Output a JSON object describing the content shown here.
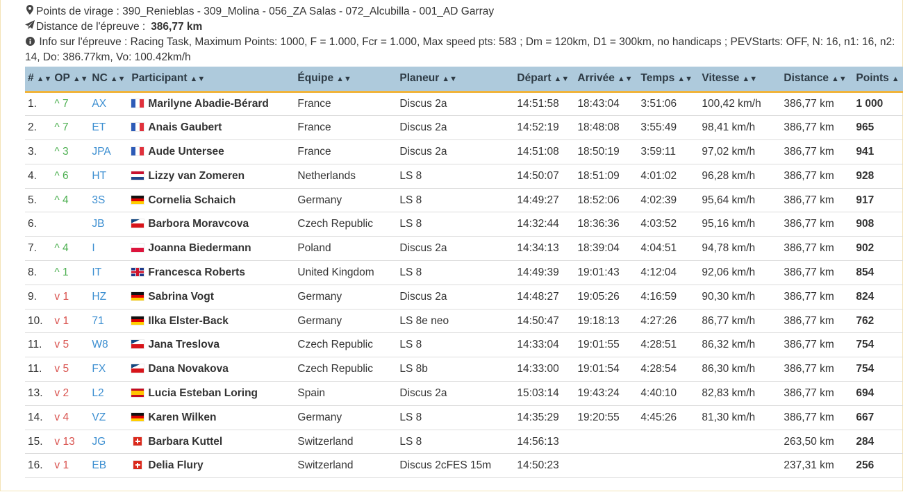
{
  "info": {
    "turnpoints_label": "Points de virage :",
    "turnpoints_value": "390_Renieblas - 309_Molina - 056_ZA Salas - 072_Alcubilla - 001_AD Garray",
    "distance_label": "Distance de l'épreuve :",
    "distance_value": "386,77 km",
    "task_info_label": "Info sur l'épreuve :",
    "task_info_value": "Racing Task, Maximum Points: 1000, F = 1.000, Fcr = 1.000, Max speed pts: 583 ; Dm = 120km, D1 = 300km, no handicaps ; PEVStarts: OFF, N: 16, n1: 16, n2: 14, Do: 386.77km, Vo: 100.42km/h"
  },
  "icons": {
    "turnpoints": "map-marker-icon",
    "distance": "paper-plane-icon",
    "info": "info-circle-icon"
  },
  "colors": {
    "header_bg": "#aecadc",
    "header_border": "#f0b43c",
    "up": "#4caf50",
    "down": "#d9534f",
    "link": "#3d8fd1"
  },
  "columns": [
    "#",
    "OP",
    "NC",
    "Participant",
    "Équipe",
    "Planeur",
    "Départ",
    "Arrivée",
    "Temps",
    "Vitesse",
    "Distance",
    "Points"
  ],
  "rows": [
    {
      "rank": "1.",
      "op": "^ 7",
      "dir": "up",
      "nc": "AX",
      "flag": "fr",
      "name": "Marilyne Abadie-Bérard",
      "team": "France",
      "glider": "Discus 2a",
      "start": "14:51:58",
      "finish": "18:43:04",
      "time": "3:51:06",
      "speed": "100,42 km/h",
      "distance": "386,77 km",
      "points": "1 000"
    },
    {
      "rank": "2.",
      "op": "^ 7",
      "dir": "up",
      "nc": "ET",
      "flag": "fr",
      "name": "Anais Gaubert",
      "team": "France",
      "glider": "Discus 2a",
      "start": "14:52:19",
      "finish": "18:48:08",
      "time": "3:55:49",
      "speed": "98,41 km/h",
      "distance": "386,77 km",
      "points": "965"
    },
    {
      "rank": "3.",
      "op": "^ 3",
      "dir": "up",
      "nc": "JPA",
      "flag": "fr",
      "name": "Aude Untersee",
      "team": "France",
      "glider": "Discus 2a",
      "start": "14:51:08",
      "finish": "18:50:19",
      "time": "3:59:11",
      "speed": "97,02 km/h",
      "distance": "386,77 km",
      "points": "941"
    },
    {
      "rank": "4.",
      "op": "^ 6",
      "dir": "up",
      "nc": "HT",
      "flag": "nl",
      "name": "Lizzy van Zomeren",
      "team": "Netherlands",
      "glider": "LS 8",
      "start": "14:50:07",
      "finish": "18:51:09",
      "time": "4:01:02",
      "speed": "96,28 km/h",
      "distance": "386,77 km",
      "points": "928"
    },
    {
      "rank": "5.",
      "op": "^ 4",
      "dir": "up",
      "nc": "3S",
      "flag": "de",
      "name": "Cornelia Schaich",
      "team": "Germany",
      "glider": "LS 8",
      "start": "14:49:27",
      "finish": "18:52:06",
      "time": "4:02:39",
      "speed": "95,64 km/h",
      "distance": "386,77 km",
      "points": "917"
    },
    {
      "rank": "6.",
      "op": "",
      "dir": "",
      "nc": "JB",
      "flag": "cz",
      "name": "Barbora Moravcova",
      "team": "Czech Republic",
      "glider": "LS 8",
      "start": "14:32:44",
      "finish": "18:36:36",
      "time": "4:03:52",
      "speed": "95,16 km/h",
      "distance": "386,77 km",
      "points": "908"
    },
    {
      "rank": "7.",
      "op": "^ 4",
      "dir": "up",
      "nc": "I",
      "flag": "pl",
      "name": "Joanna Biedermann",
      "team": "Poland",
      "glider": "Discus 2a",
      "start": "14:34:13",
      "finish": "18:39:04",
      "time": "4:04:51",
      "speed": "94,78 km/h",
      "distance": "386,77 km",
      "points": "902"
    },
    {
      "rank": "8.",
      "op": "^ 1",
      "dir": "up",
      "nc": "IT",
      "flag": "gb",
      "name": "Francesca Roberts",
      "team": "United Kingdom",
      "glider": "LS 8",
      "start": "14:49:39",
      "finish": "19:01:43",
      "time": "4:12:04",
      "speed": "92,06 km/h",
      "distance": "386,77 km",
      "points": "854"
    },
    {
      "rank": "9.",
      "op": "v 1",
      "dir": "down",
      "nc": "HZ",
      "flag": "de",
      "name": "Sabrina Vogt",
      "team": "Germany",
      "glider": "Discus 2a",
      "start": "14:48:27",
      "finish": "19:05:26",
      "time": "4:16:59",
      "speed": "90,30 km/h",
      "distance": "386,77 km",
      "points": "824"
    },
    {
      "rank": "10.",
      "op": "v 1",
      "dir": "down",
      "nc": "71",
      "flag": "de",
      "name": "Ilka Elster-Back",
      "team": "Germany",
      "glider": "LS 8e neo",
      "start": "14:50:47",
      "finish": "19:18:13",
      "time": "4:27:26",
      "speed": "86,77 km/h",
      "distance": "386,77 km",
      "points": "762"
    },
    {
      "rank": "11.",
      "op": "v 5",
      "dir": "down",
      "nc": "W8",
      "flag": "cz",
      "name": "Jana Treslova",
      "team": "Czech Republic",
      "glider": "LS 8",
      "start": "14:33:04",
      "finish": "19:01:55",
      "time": "4:28:51",
      "speed": "86,32 km/h",
      "distance": "386,77 km",
      "points": "754"
    },
    {
      "rank": "11.",
      "op": "v 5",
      "dir": "down",
      "nc": "FX",
      "flag": "cz",
      "name": "Dana Novakova",
      "team": "Czech Republic",
      "glider": "LS 8b",
      "start": "14:33:00",
      "finish": "19:01:54",
      "time": "4:28:54",
      "speed": "86,30 km/h",
      "distance": "386,77 km",
      "points": "754"
    },
    {
      "rank": "13.",
      "op": "v 2",
      "dir": "down",
      "nc": "L2",
      "flag": "es",
      "name": "Lucia Esteban Loring",
      "team": "Spain",
      "glider": "Discus 2a",
      "start": "15:03:14",
      "finish": "19:43:24",
      "time": "4:40:10",
      "speed": "82,83 km/h",
      "distance": "386,77 km",
      "points": "694"
    },
    {
      "rank": "14.",
      "op": "v 4",
      "dir": "down",
      "nc": "VZ",
      "flag": "de",
      "name": "Karen Wilken",
      "team": "Germany",
      "glider": "LS 8",
      "start": "14:35:29",
      "finish": "19:20:55",
      "time": "4:45:26",
      "speed": "81,30 km/h",
      "distance": "386,77 km",
      "points": "667"
    },
    {
      "rank": "15.",
      "op": "v 13",
      "dir": "down",
      "nc": "JG",
      "flag": "ch",
      "name": "Barbara Kuttel",
      "team": "Switzerland",
      "glider": "LS 8",
      "start": "14:56:13",
      "finish": "",
      "time": "",
      "speed": "",
      "distance": "263,50 km",
      "points": "284"
    },
    {
      "rank": "16.",
      "op": "v 1",
      "dir": "down",
      "nc": "EB",
      "flag": "ch",
      "name": "Delia Flury",
      "team": "Switzerland",
      "glider": "Discus 2cFES 15m",
      "start": "14:50:23",
      "finish": "",
      "time": "",
      "speed": "",
      "distance": "237,31 km",
      "points": "256"
    }
  ]
}
